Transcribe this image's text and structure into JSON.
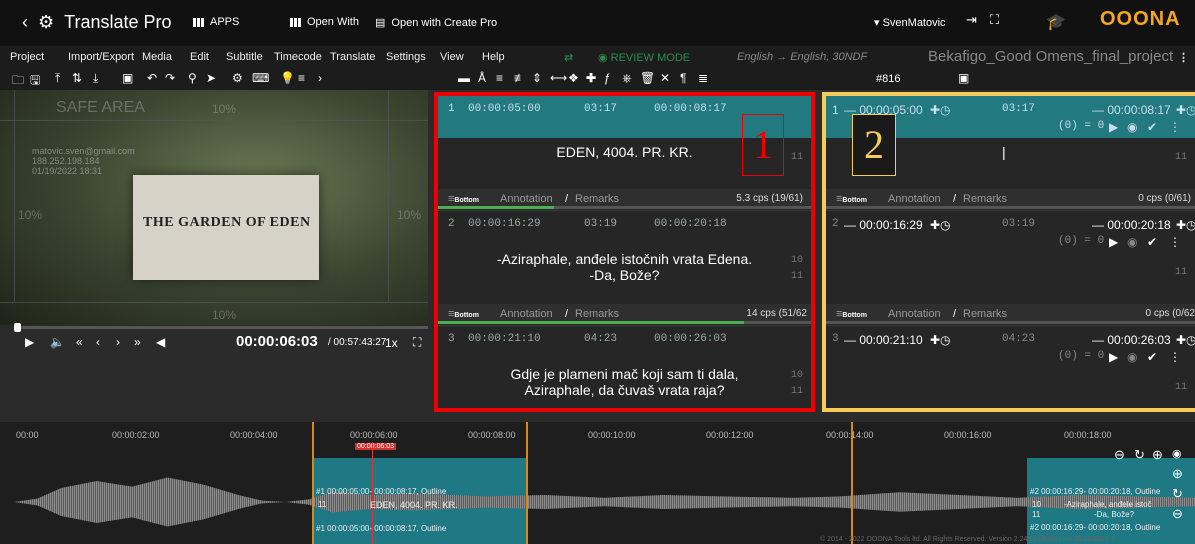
{
  "app": {
    "title": "Translate Pro",
    "apps": "APPS",
    "open_with": "Open With",
    "open_cp": "Open with Create Pro",
    "user": "SvenMatovic",
    "brand": "OOONA"
  },
  "menu": [
    "Project",
    "Import/Export",
    "Media",
    "Edit",
    "Subtitle",
    "Timecode",
    "Translate",
    "Settings",
    "View",
    "Help"
  ],
  "review_mode": "REVIEW MODE",
  "lang": "English → English, 30NDF",
  "project": "Bekafigo_Good Omens_final_project",
  "sub_counter": "#816",
  "video": {
    "safe": "SAFE AREA",
    "pct": "10%",
    "wm1": "matovic.sven@gmail.com",
    "wm2": "188.252.198.184",
    "wm3": "01/19/2022 18:31",
    "sign": "THE GARDEN OF EDEN",
    "tc": "00:00:06:03",
    "dur": "/ 00:57:43:27",
    "speed": "1x"
  },
  "panel1": [
    {
      "n": "1",
      "in": "00:00:05:00",
      "d": "03:17",
      "out": "00:00:08:17",
      "text": "EDEN, 4004. PR. KR.",
      "c1": "11",
      "c2": "",
      "cps": "5.3 cps (19/61)",
      "bar": 0.31
    },
    {
      "n": "2",
      "in": "00:00:16:29",
      "d": "03:19",
      "out": "00:00:20:18",
      "text": "-Aziraphale, anđele istočnih vrata Edena.\n-Da, Bože?",
      "c1": "10",
      "c2": "11",
      "cps": "14 cps (51/62",
      "bar": 0.82
    },
    {
      "n": "3",
      "in": "00:00:21:10",
      "d": "04:23",
      "out": "00:00:26:03",
      "text": "Gdje je plameni mač koji sam ti dala,\nAziraphale, da čuvaš vrata raja?",
      "c1": "10",
      "c2": "11",
      "cps": "",
      "bar": 0
    }
  ],
  "panel2": [
    {
      "n": "1",
      "in": "— 00:00:05:00",
      "d": "03:17",
      "out": "— 00:00:08:17",
      "cnt": "(0) = 0",
      "c": "11",
      "cps": "0 cps (0/61)"
    },
    {
      "n": "2",
      "in": "— 00:00:16:29",
      "d": "03:19",
      "out": "— 00:00:20:18",
      "cnt": "(0) = 0",
      "c": "11",
      "cps": "0 cps (0/62"
    },
    {
      "n": "3",
      "in": "— 00:00:21:10",
      "d": "04:23",
      "out": "— 00:00:26:03",
      "cnt": "(0) = 0",
      "c": "11",
      "cps": ""
    }
  ],
  "foot": {
    "bottom": "Bottom",
    "annotation": "Annotation",
    "slash": "/",
    "remarks": "Remarks"
  },
  "labels": {
    "one": "1",
    "two": "2"
  },
  "timeline": {
    "ticks": [
      "00:00",
      "00:00:02:00",
      "00:00:04:00",
      "00:00:06:00",
      "00:00:08:00",
      "00:00:10:00",
      "00:00:12:00",
      "00:00:14:00",
      "00:00:16:00",
      "00:00:18:00"
    ],
    "playhead": "00:00:06:03",
    "seg1a": "#1 00:00:05:00- 00:00:08:17, Outline",
    "seg1b": "11",
    "seg1c": "EDEN, 4004. PR. KR.",
    "seg1d": "#1 00:00:05:00- 00:00:08:17, Outline",
    "seg2a": "#2 00:00:16:29- 00:00:20:18, Outline",
    "seg2b": "10",
    "seg2c": "-Aziraphale, anđele istoč",
    "seg2d": "11",
    "seg2e": "-Da, Bože?",
    "seg2f": "#2 00:00:16:29- 00:00:20:18, Outline"
  },
  "copyright": "© 2014 - 2022 OOONA Tools ltd. All Rights Reserved. Version 2.24.10 (Build time 20/12/2021 2"
}
